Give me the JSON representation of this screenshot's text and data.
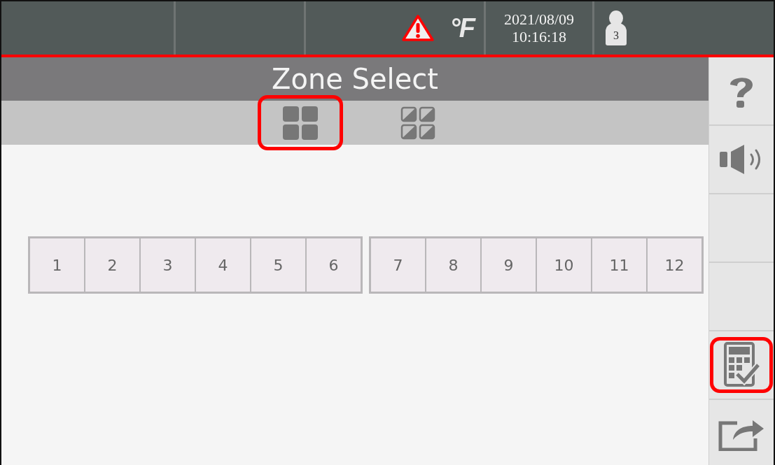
{
  "status_bar": {
    "unit": "°F",
    "date": "2021/08/09",
    "time": "10:16:18",
    "user_level": "3"
  },
  "title": "Zone Select",
  "view_modes": [
    {
      "kind": "grid",
      "highlighted": true
    },
    {
      "kind": "split-grid",
      "highlighted": false
    }
  ],
  "zone_groups": [
    [
      "1",
      "2",
      "3",
      "4",
      "5",
      "6"
    ],
    [
      "7",
      "8",
      "9",
      "10",
      "11",
      "12"
    ]
  ],
  "side_buttons": [
    {
      "kind": "help",
      "highlighted": false
    },
    {
      "kind": "sound",
      "highlighted": false
    },
    {
      "kind": "blank",
      "highlighted": false
    },
    {
      "kind": "blank",
      "highlighted": false
    },
    {
      "kind": "calc-check",
      "highlighted": true
    },
    {
      "kind": "export",
      "highlighted": false
    }
  ]
}
